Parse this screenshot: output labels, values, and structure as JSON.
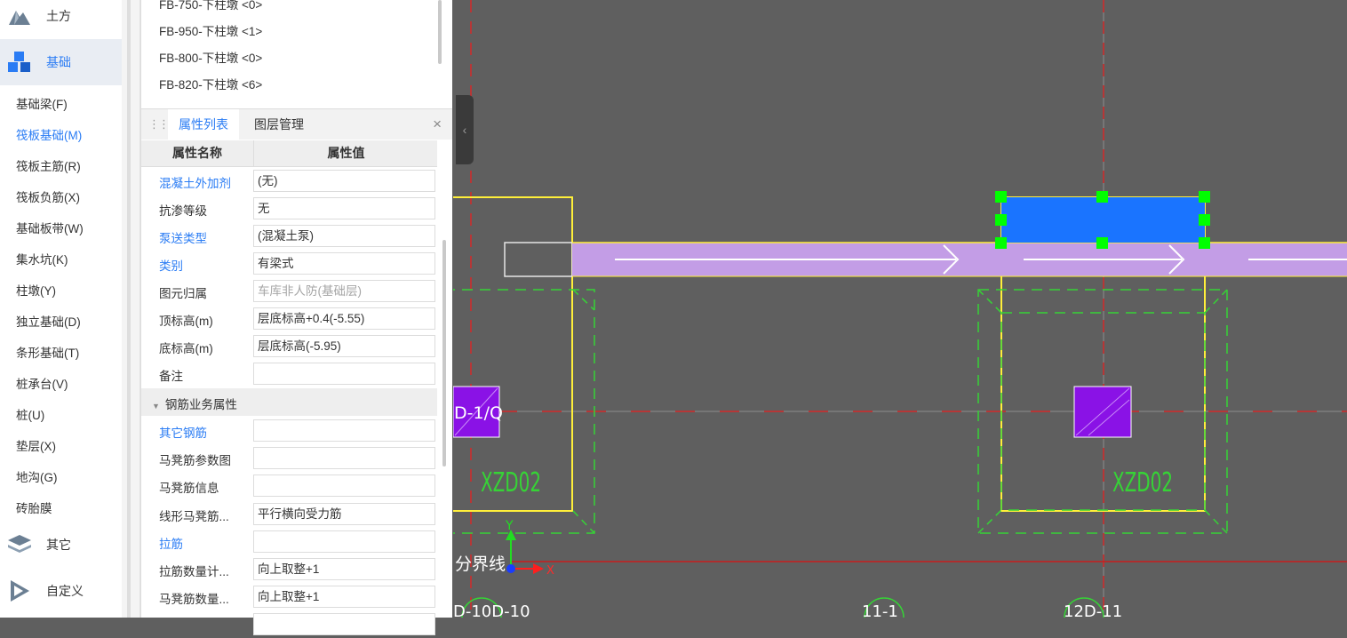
{
  "leftnav": {
    "categories": [
      {
        "label": "土方",
        "icon": "earthwork-icon"
      },
      {
        "label": "基础",
        "icon": "foundation-cubes-icon"
      },
      {
        "label": "其它",
        "icon": "layers-stack-icon"
      },
      {
        "label": "自定义",
        "icon": "custom-arrow-icon"
      }
    ],
    "items": [
      "基础梁(F)",
      "筏板基础(M)",
      "筏板主筋(R)",
      "筏板负筋(X)",
      "基础板带(W)",
      "集水坑(K)",
      "柱墩(Y)",
      "独立基础(D)",
      "条形基础(T)",
      "桩承台(V)",
      "桩(U)",
      "垫层(X)",
      "地沟(G)",
      "砖胎膜"
    ],
    "active_item": "筏板基础(M)"
  },
  "component_list": [
    "FB-750-下柱墩 <0>",
    "FB-950-下柱墩 <1>",
    "FB-800-下柱墩 <0>",
    "FB-820-下柱墩 <6>"
  ],
  "props_panel": {
    "tabs": [
      "属性列表",
      "图层管理"
    ],
    "active_tab": "属性列表",
    "close_label": "×",
    "header_name": "属性名称",
    "header_value": "属性值",
    "rows": [
      {
        "name": "混凝土外加剂",
        "value": "(无)",
        "blue": true
      },
      {
        "name": "抗渗等级",
        "value": "无"
      },
      {
        "name": "泵送类型",
        "value": "(混凝土泵)",
        "blue": true
      },
      {
        "name": "类别",
        "value": "有梁式",
        "blue": true
      },
      {
        "name": "图元归属",
        "value": "车库非人防(基础层)",
        "gray": true
      },
      {
        "name": "顶标高(m)",
        "value": "层底标高+0.4(-5.55)"
      },
      {
        "name": "底标高(m)",
        "value": "层底标高(-5.95)"
      },
      {
        "name": "备注",
        "value": ""
      },
      {
        "name": "钢筋业务属性",
        "group": true
      },
      {
        "name": "其它钢筋",
        "value": "",
        "blue": true
      },
      {
        "name": "马凳筋参数图",
        "value": ""
      },
      {
        "name": "马凳筋信息",
        "value": ""
      },
      {
        "name": "线形马凳筋...",
        "value": "平行横向受力筋"
      },
      {
        "name": "拉筋",
        "value": "",
        "blue": true
      },
      {
        "name": "拉筋数量计...",
        "value": "向上取整+1"
      },
      {
        "name": "马凳筋数量...",
        "value": "向上取整+1"
      }
    ]
  },
  "canvas": {
    "labels": {
      "col_tag_left": "D-1/Q",
      "xzd_left": "XZD02",
      "xzd_right": "XZD02",
      "boundary": "分界线",
      "axis_y": "Y",
      "axis_x": "X",
      "axis_bottom_1": "D-10D-10",
      "axis_bottom_2": "11-1",
      "axis_bottom_3": "12D-11"
    },
    "colors": {
      "background": "#5f5f5f",
      "yellow": "#ffef3a",
      "green_dash": "#36d336",
      "red_dash": "#d32a2a",
      "beam_fill": "#c39de6",
      "selected_blue": "#1a74ff",
      "grip_green": "#00ff00",
      "pile_purple": "#8a12e6"
    }
  }
}
